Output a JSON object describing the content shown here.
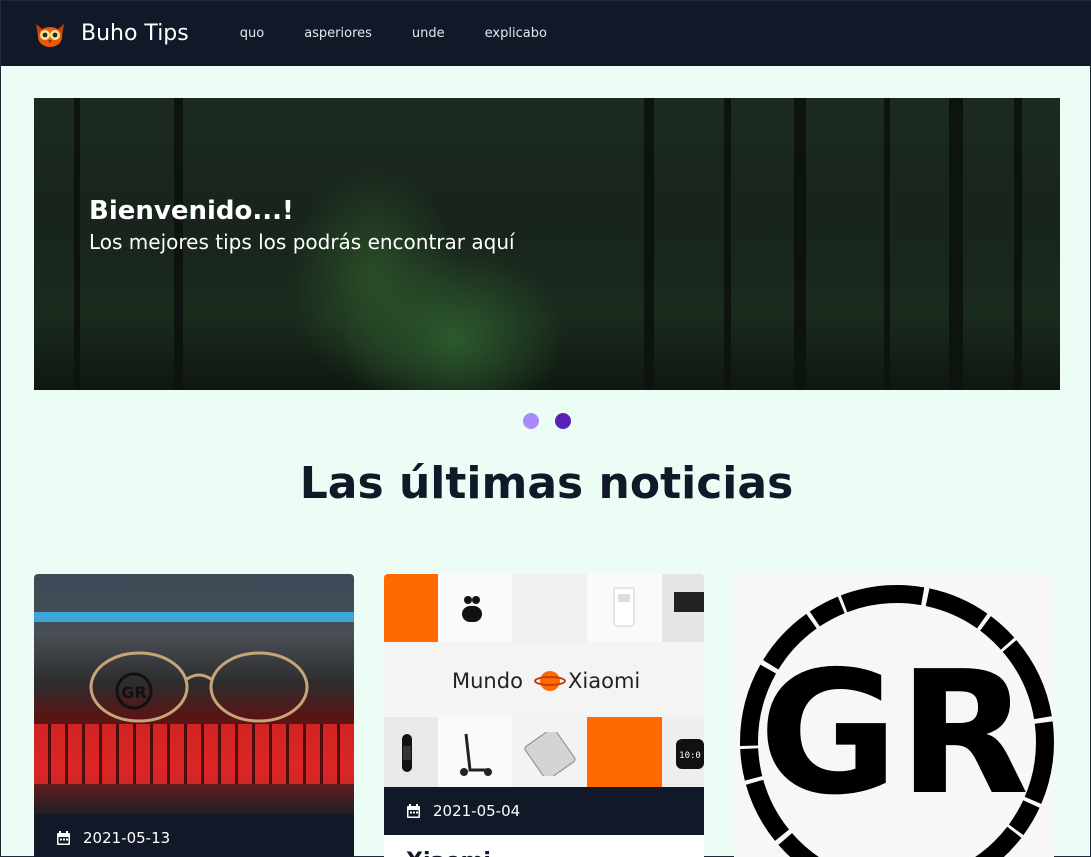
{
  "header": {
    "brand": "Buho Tips",
    "nav": [
      "quo",
      "asperiores",
      "unde",
      "explicabo"
    ]
  },
  "hero": {
    "title": "Bienvenido...!",
    "subtitle": "Los mejores tips los podrás encontrar aquí"
  },
  "carousel": {
    "slides": 2,
    "active": 2
  },
  "section": {
    "title": "Las últimas noticias"
  },
  "cards": [
    {
      "date": "2021-05-13",
      "image_logo": "GR"
    },
    {
      "date": "2021-05-04",
      "image_logo": "Mundo Xiaomi",
      "title_partial": "Xiaomi"
    },
    {
      "image_logo": "GR"
    }
  ],
  "colors": {
    "navbar": "#111827",
    "page_bg": "#ecfdf5",
    "dot_inactive": "#a78bfa",
    "dot_active": "#5b21b6",
    "xiaomi_orange": "#ff6900"
  }
}
